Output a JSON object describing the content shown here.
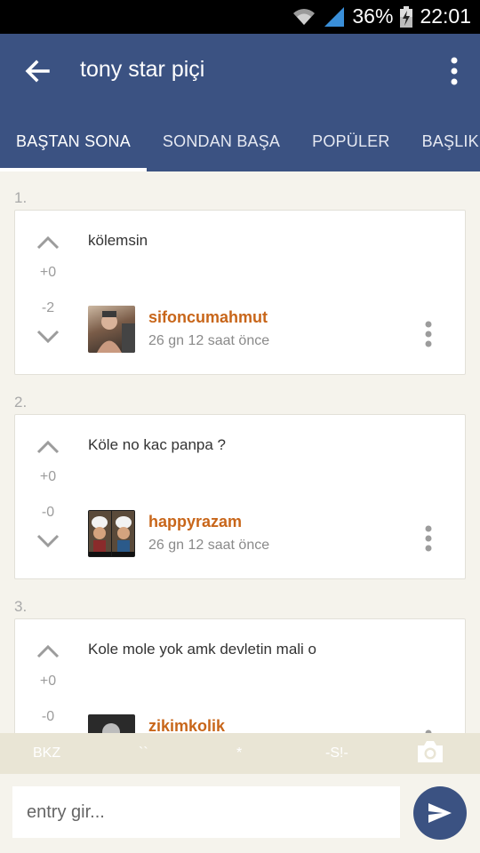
{
  "status_bar": {
    "battery": "36%",
    "time": "22:01"
  },
  "header": {
    "title": "tony star piçi"
  },
  "tabs": [
    {
      "label": "BAŞTAN SONA",
      "active": true
    },
    {
      "label": "SONDAN BAŞA",
      "active": false
    },
    {
      "label": "POPÜLER",
      "active": false
    },
    {
      "label": "BAŞLIK S",
      "active": false
    }
  ],
  "entries": [
    {
      "number": "1.",
      "text": "kölemsin",
      "upvotes": "+0",
      "downvotes": "-2",
      "author": "sifoncumahmut",
      "time_ago": "26 gn 12 saat  önce"
    },
    {
      "number": "2.",
      "text": "Köle no kac panpa ?",
      "upvotes": "+0",
      "downvotes": "-0",
      "author": "happyrazam",
      "time_ago": "26 gn 12 saat  önce"
    },
    {
      "number": "3.",
      "text": "Kole mole yok amk devletin mali o",
      "upvotes": "+0",
      "downvotes": "-0",
      "author": "zikimkolik",
      "time_ago": ""
    }
  ],
  "toolbar": {
    "bkz": "BKZ",
    "backtick": "``",
    "asterisk": "*",
    "spoiler": "-S!-"
  },
  "input": {
    "placeholder": "entry gir..."
  },
  "colors": {
    "primary": "#3b5282",
    "author": "#c8661a",
    "background": "#f5f3ec",
    "toolbar": "#e9e5d5"
  }
}
